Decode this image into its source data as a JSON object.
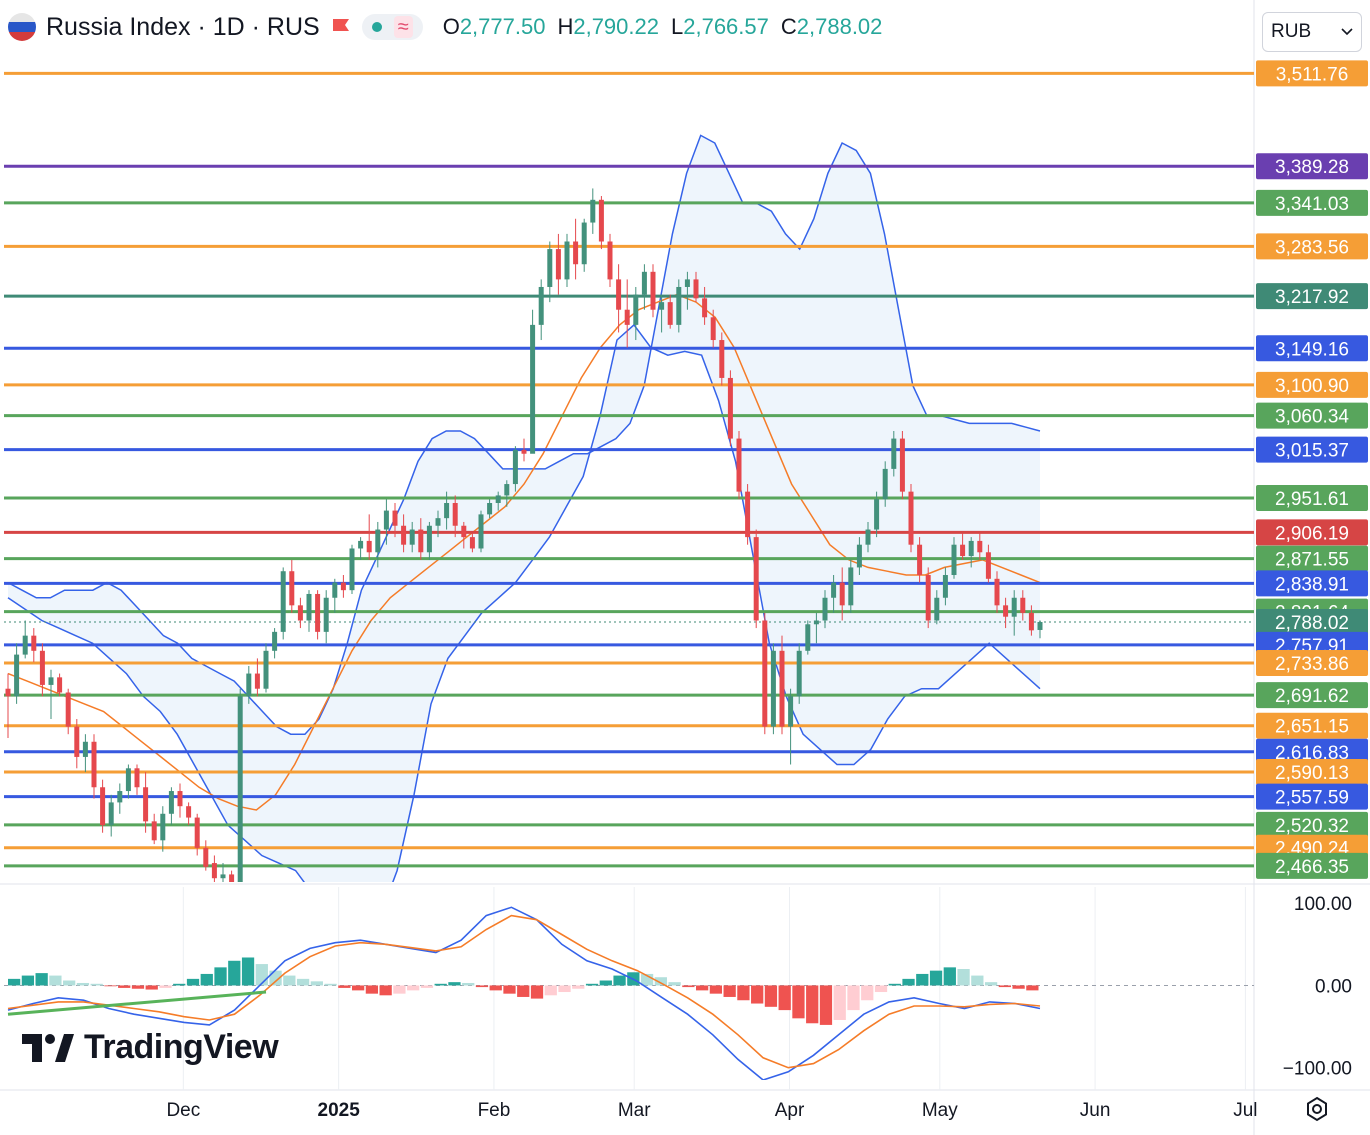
{
  "header": {
    "symbol_title": "Russia Index · 1D · RUS",
    "ohlc": [
      {
        "key": "O",
        "value": "2,777.50"
      },
      {
        "key": "H",
        "value": "2,790.22"
      },
      {
        "key": "L",
        "value": "2,766.57"
      },
      {
        "key": "C",
        "value": "2,788.02"
      }
    ]
  },
  "currency_selector": {
    "value": "RUB"
  },
  "logo": {
    "text": "TradingView"
  },
  "colors": {
    "up": "#26a69a",
    "up_candle": "#43917c",
    "down": "#e5484d",
    "bb_line": "#3563e9",
    "basis": "#f57c28",
    "band_fill": "#eaf2fb",
    "level_orange": "#f59e36",
    "level_green": "#58a55c",
    "level_blue": "#3759e0",
    "level_purple": "#6a3fb0",
    "level_teal": "#3f8a76",
    "level_red": "#d64545"
  },
  "chart_data": {
    "type": "candlestick",
    "price_axis": {
      "min": 2445,
      "max": 3540
    },
    "x_axis_labels": [
      {
        "label": "Dec",
        "day": 35
      },
      {
        "label": "2025",
        "day": 66,
        "bold": true
      },
      {
        "label": "Feb",
        "day": 97
      },
      {
        "label": "Mar",
        "day": 125
      },
      {
        "label": "Apr",
        "day": 156
      },
      {
        "label": "May",
        "day": 186
      },
      {
        "label": "Jun",
        "day": 217
      },
      {
        "label": "Jul",
        "day": 247
      }
    ],
    "levels": [
      {
        "price": 3511.76,
        "label": "3,511.76",
        "color": "orange"
      },
      {
        "price": 3389.28,
        "label": "3,389.28",
        "color": "purple"
      },
      {
        "price": 3341.03,
        "label": "3,341.03",
        "color": "green"
      },
      {
        "price": 3283.56,
        "label": "3,283.56",
        "color": "orange"
      },
      {
        "price": 3217.92,
        "label": "3,217.92",
        "color": "teal"
      },
      {
        "price": 3149.16,
        "label": "3,149.16",
        "color": "blue"
      },
      {
        "price": 3100.9,
        "label": "3,100.90",
        "color": "orange"
      },
      {
        "price": 3060.34,
        "label": "3,060.34",
        "color": "green"
      },
      {
        "price": 3015.37,
        "label": "3,015.37",
        "color": "blue"
      },
      {
        "price": 2951.61,
        "label": "2,951.61",
        "color": "green"
      },
      {
        "price": 2906.19,
        "label": "2,906.19",
        "color": "red"
      },
      {
        "price": 2871.55,
        "label": "2,871.55",
        "color": "green"
      },
      {
        "price": 2838.91,
        "label": "2,838.91",
        "color": "blue"
      },
      {
        "price": 2801.64,
        "label": "2,801.64",
        "color": "green"
      },
      {
        "price": 2788.02,
        "label": "2,788.02",
        "color": "teal",
        "dotted": true
      },
      {
        "price": 2757.91,
        "label": "2,757.91",
        "color": "blue"
      },
      {
        "price": 2733.86,
        "label": "2,733.86",
        "color": "orange"
      },
      {
        "price": 2691.62,
        "label": "2,691.62",
        "color": "green"
      },
      {
        "price": 2651.15,
        "label": "2,651.15",
        "color": "orange"
      },
      {
        "price": 2616.83,
        "label": "2,616.83",
        "color": "blue"
      },
      {
        "price": 2590.13,
        "label": "2,590.13",
        "color": "orange"
      },
      {
        "price": 2557.59,
        "label": "2,557.59",
        "color": "blue"
      },
      {
        "price": 2520.32,
        "label": "2,520.32",
        "color": "green"
      },
      {
        "price": 2490.24,
        "label": "2,490.24",
        "color": "orange"
      },
      {
        "price": 2466.35,
        "label": "2,466.35",
        "color": "green"
      }
    ],
    "candles": [
      [
        2700,
        2720,
        2635,
        2690
      ],
      [
        2690,
        2760,
        2680,
        2745
      ],
      [
        2745,
        2790,
        2740,
        2770
      ],
      [
        2770,
        2780,
        2735,
        2750
      ],
      [
        2750,
        2760,
        2690,
        2705
      ],
      [
        2705,
        2725,
        2660,
        2715
      ],
      [
        2715,
        2720,
        2690,
        2695
      ],
      [
        2695,
        2700,
        2640,
        2650
      ],
      [
        2650,
        2660,
        2595,
        2610
      ],
      [
        2610,
        2640,
        2590,
        2630
      ],
      [
        2630,
        2640,
        2555,
        2570
      ],
      [
        2570,
        2580,
        2510,
        2520
      ],
      [
        2520,
        2560,
        2505,
        2550
      ],
      [
        2550,
        2575,
        2535,
        2565
      ],
      [
        2565,
        2600,
        2555,
        2595
      ],
      [
        2595,
        2600,
        2560,
        2570
      ],
      [
        2570,
        2590,
        2510,
        2525
      ],
      [
        2525,
        2535,
        2495,
        2500
      ],
      [
        2500,
        2545,
        2485,
        2535
      ],
      [
        2535,
        2570,
        2520,
        2565
      ],
      [
        2565,
        2575,
        2530,
        2545
      ],
      [
        2545,
        2550,
        2520,
        2530
      ],
      [
        2530,
        2535,
        2480,
        2490
      ],
      [
        2490,
        2500,
        2460,
        2465
      ],
      [
        2470,
        2480,
        2440,
        2450
      ],
      [
        2450,
        2470,
        2420,
        2455
      ],
      [
        2455,
        2460,
        2400,
        2410
      ],
      [
        2410,
        2700,
        2405,
        2690
      ],
      [
        2690,
        2730,
        2680,
        2720
      ],
      [
        2720,
        2740,
        2690,
        2700
      ],
      [
        2700,
        2760,
        2695,
        2750
      ],
      [
        2750,
        2780,
        2740,
        2775
      ],
      [
        2775,
        2860,
        2765,
        2855
      ],
      [
        2855,
        2870,
        2800,
        2810
      ],
      [
        2810,
        2820,
        2780,
        2790
      ],
      [
        2790,
        2830,
        2775,
        2825
      ],
      [
        2825,
        2830,
        2765,
        2775
      ],
      [
        2775,
        2830,
        2760,
        2820
      ],
      [
        2820,
        2845,
        2800,
        2840
      ],
      [
        2840,
        2850,
        2820,
        2830
      ],
      [
        2830,
        2890,
        2825,
        2885
      ],
      [
        2885,
        2900,
        2870,
        2895
      ],
      [
        2895,
        2930,
        2870,
        2880
      ],
      [
        2880,
        2920,
        2860,
        2910
      ],
      [
        2910,
        2950,
        2890,
        2935
      ],
      [
        2935,
        2945,
        2900,
        2915
      ],
      [
        2915,
        2930,
        2880,
        2890
      ],
      [
        2890,
        2920,
        2880,
        2910
      ],
      [
        2910,
        2925,
        2870,
        2880
      ],
      [
        2880,
        2920,
        2870,
        2915
      ],
      [
        2915,
        2935,
        2900,
        2925
      ],
      [
        2925,
        2960,
        2910,
        2945
      ],
      [
        2945,
        2955,
        2900,
        2915
      ],
      [
        2915,
        2920,
        2885,
        2900
      ],
      [
        2900,
        2905,
        2880,
        2885
      ],
      [
        2885,
        2935,
        2880,
        2930
      ],
      [
        2930,
        2950,
        2925,
        2945
      ],
      [
        2945,
        2960,
        2935,
        2955
      ],
      [
        2955,
        2975,
        2940,
        2970
      ],
      [
        2970,
        3020,
        2960,
        3015
      ],
      [
        3015,
        3030,
        3000,
        3010
      ],
      [
        3010,
        3200,
        3150,
        3180
      ],
      [
        3180,
        3240,
        3160,
        3230
      ],
      [
        3230,
        3290,
        3210,
        3280
      ],
      [
        3280,
        3300,
        3220,
        3240
      ],
      [
        3240,
        3300,
        3230,
        3290
      ],
      [
        3290,
        3320,
        3240,
        3260
      ],
      [
        3260,
        3320,
        3250,
        3315
      ],
      [
        3315,
        3360,
        3300,
        3345
      ],
      [
        3345,
        3350,
        3280,
        3290
      ],
      [
        3290,
        3300,
        3230,
        3240
      ],
      [
        3240,
        3260,
        3170,
        3200
      ],
      [
        3200,
        3240,
        3150,
        3180
      ],
      [
        3180,
        3230,
        3160,
        3220
      ],
      [
        3220,
        3260,
        3200,
        3250
      ],
      [
        3250,
        3260,
        3190,
        3200
      ],
      [
        3200,
        3220,
        3170,
        3210
      ],
      [
        3210,
        3220,
        3175,
        3180
      ],
      [
        3180,
        3240,
        3170,
        3230
      ],
      [
        3230,
        3250,
        3200,
        3240
      ],
      [
        3240,
        3250,
        3210,
        3215
      ],
      [
        3215,
        3230,
        3180,
        3190
      ],
      [
        3190,
        3200,
        3150,
        3160
      ],
      [
        3160,
        3170,
        3100,
        3110
      ],
      [
        3110,
        3120,
        3020,
        3030
      ],
      [
        3030,
        3040,
        2950,
        2960
      ],
      [
        2960,
        2970,
        2890,
        2900
      ],
      [
        2900,
        2910,
        2780,
        2790
      ],
      [
        2790,
        2800,
        2640,
        2650
      ],
      [
        2650,
        2760,
        2640,
        2750
      ],
      [
        2750,
        2770,
        2640,
        2650
      ],
      [
        2650,
        2700,
        2600,
        2690
      ],
      [
        2690,
        2760,
        2680,
        2750
      ],
      [
        2750,
        2790,
        2745,
        2785
      ],
      [
        2785,
        2800,
        2760,
        2790
      ],
      [
        2790,
        2830,
        2780,
        2820
      ],
      [
        2820,
        2850,
        2800,
        2840
      ],
      [
        2840,
        2860,
        2790,
        2810
      ],
      [
        2810,
        2870,
        2800,
        2860
      ],
      [
        2860,
        2900,
        2850,
        2890
      ],
      [
        2890,
        2920,
        2880,
        2910
      ],
      [
        2910,
        2960,
        2900,
        2950
      ],
      [
        2950,
        3000,
        2940,
        2990
      ],
      [
        2990,
        3040,
        2980,
        3030
      ],
      [
        3030,
        3040,
        2950,
        2960
      ],
      [
        2960,
        2970,
        2880,
        2890
      ],
      [
        2890,
        2900,
        2840,
        2850
      ],
      [
        2850,
        2860,
        2780,
        2790
      ],
      [
        2790,
        2830,
        2785,
        2820
      ],
      [
        2820,
        2860,
        2810,
        2850
      ],
      [
        2850,
        2900,
        2845,
        2890
      ],
      [
        2890,
        2905,
        2870,
        2875
      ],
      [
        2875,
        2900,
        2860,
        2895
      ],
      [
        2895,
        2905,
        2870,
        2880
      ],
      [
        2880,
        2890,
        2840,
        2845
      ],
      [
        2845,
        2855,
        2800,
        2810
      ],
      [
        2810,
        2820,
        2780,
        2795
      ],
      [
        2795,
        2830,
        2770,
        2820
      ],
      [
        2820,
        2830,
        2790,
        2800
      ],
      [
        2800,
        2810,
        2770,
        2777
      ],
      [
        2777.5,
        2790.22,
        2766.57,
        2788.02
      ]
    ],
    "bollinger": {
      "upper": [
        2840,
        2830,
        2820,
        2820,
        2830,
        2830,
        2830,
        2840,
        2830,
        2810,
        2790,
        2770,
        2760,
        2740,
        2730,
        2720,
        2710,
        2690,
        2670,
        2650,
        2640,
        2640,
        2660,
        2700,
        2760,
        2830,
        2870,
        2910,
        2950,
        3000,
        3030,
        3040,
        3040,
        3030,
        3010,
        2990,
        2990,
        2990,
        2990,
        3000,
        3010,
        3010,
        3020,
        3030,
        3050,
        3100,
        3200,
        3300,
        3380,
        3430,
        3420,
        3380,
        3340,
        3340,
        3330,
        3300,
        3280,
        3320,
        3380,
        3420,
        3410,
        3380,
        3300,
        3200,
        3100,
        3060,
        3060,
        3055,
        3050,
        3050,
        3050,
        3050,
        3045,
        3040
      ],
      "lower": [
        2820,
        2805,
        2790,
        2780,
        2770,
        2760,
        2740,
        2720,
        2690,
        2670,
        2640,
        2600,
        2560,
        2520,
        2500,
        2480,
        2470,
        2460,
        2430,
        2400,
        2380,
        2380,
        2400,
        2460,
        2560,
        2680,
        2740,
        2770,
        2800,
        2820,
        2840,
        2870,
        2900,
        2940,
        2980,
        3060,
        3160,
        3180,
        3150,
        3140,
        3145,
        3140,
        3080,
        3000,
        2880,
        2760,
        2690,
        2640,
        2620,
        2600,
        2600,
        2620,
        2660,
        2690,
        2700,
        2700,
        2720,
        2740,
        2760,
        2740,
        2720,
        2700
      ],
      "basis": [
        2720,
        2710,
        2700,
        2690,
        2680,
        2670,
        2650,
        2630,
        2610,
        2590,
        2570,
        2555,
        2545,
        2540,
        2560,
        2600,
        2650,
        2700,
        2750,
        2790,
        2820,
        2840,
        2860,
        2880,
        2900,
        2920,
        2940,
        2970,
        3010,
        3060,
        3110,
        3150,
        3180,
        3200,
        3210,
        3220,
        3210,
        3190,
        3150,
        3090,
        3030,
        2970,
        2930,
        2890,
        2870,
        2860,
        2855,
        2850,
        2850,
        2860,
        2865,
        2870,
        2860,
        2850,
        2840
      ]
    },
    "macd_axis": {
      "min": -115,
      "max": 110,
      "ticks": [
        "100.00",
        "0.00",
        "−100.00"
      ]
    },
    "macd": {
      "macd_line": [
        -30,
        -22,
        -15,
        -18,
        -28,
        -35,
        -40,
        -45,
        -48,
        -30,
        0,
        30,
        45,
        52,
        55,
        50,
        45,
        40,
        55,
        85,
        95,
        80,
        50,
        30,
        20,
        5,
        -15,
        -35,
        -60,
        -90,
        -115,
        -105,
        -85,
        -60,
        -35,
        -20,
        -15,
        -22,
        -28,
        -20,
        -22,
        -28
      ],
      "signal_line": [
        -28,
        -24,
        -20,
        -20,
        -24,
        -28,
        -32,
        -38,
        -42,
        -35,
        -12,
        15,
        35,
        48,
        52,
        50,
        46,
        42,
        47,
        68,
        85,
        80,
        62,
        44,
        30,
        18,
        2,
        -15,
        -35,
        -60,
        -88,
        -100,
        -95,
        -78,
        -55,
        -35,
        -25,
        -25,
        -26,
        -23,
        -22,
        -25
      ],
      "histogram": [
        8,
        12,
        15,
        12,
        6,
        3,
        2,
        -1,
        -3,
        -4,
        -5,
        -3,
        2,
        8,
        14,
        22,
        30,
        34,
        26,
        18,
        12,
        8,
        5,
        2,
        -3,
        -6,
        -10,
        -12,
        -10,
        -6,
        -3,
        2,
        4,
        3,
        -2,
        -6,
        -10,
        -14,
        -16,
        -12,
        -8,
        -4,
        2,
        6,
        12,
        16,
        14,
        10,
        4,
        -2,
        -6,
        -10,
        -14,
        -18,
        -22,
        -26,
        -30,
        -40,
        -46,
        -48,
        -42,
        -30,
        -18,
        -8,
        2,
        8,
        14,
        18,
        22,
        20,
        12,
        4,
        -2,
        -4,
        -6
      ]
    }
  }
}
